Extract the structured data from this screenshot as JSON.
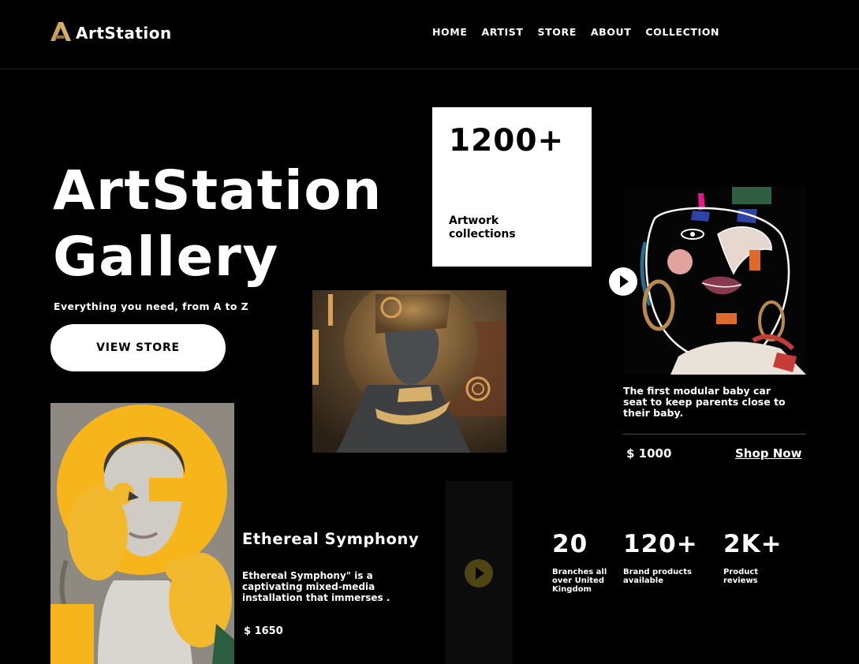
{
  "header": {
    "brand": "ArtStation",
    "nav": [
      "HOME",
      "ARTIST",
      "STORE",
      "ABOUT",
      "COLLECTION"
    ]
  },
  "hero": {
    "title_line1": "ArtStation",
    "title_line2": "Gallery",
    "subtitle": "Everything you need, from A to Z",
    "cta": "VIEW STORE"
  },
  "stat_card": {
    "number": "1200+",
    "label": "Artwork collections"
  },
  "product": {
    "description": "The first modular baby car seat to keep parents close to their baby.",
    "price": "$ 1000",
    "link": "Shop Now"
  },
  "feature": {
    "title": "Ethereal Symphony",
    "description": "Ethereal Symphony\" is a captivating mixed-media installation that immerses .",
    "price": "$ 1650"
  },
  "metrics": [
    {
      "value": "20",
      "label": "Branches all over United Kingdom"
    },
    {
      "value": "120+",
      "label": "Brand products available"
    },
    {
      "value": "2K+",
      "label": "Product reviews"
    }
  ],
  "colors": {
    "background": "#000000",
    "accent_gold": "#c9a35c",
    "accent_yellow": "#f7b51c",
    "text": "#ffffff"
  },
  "icons": {
    "logo": "triangle-a-logo",
    "play": "play-icon"
  }
}
